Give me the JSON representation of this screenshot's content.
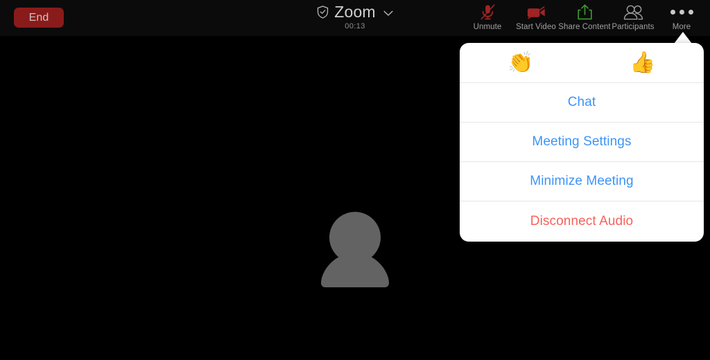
{
  "meeting": {
    "end_button_label": "End",
    "title": "Zoom",
    "timer": "00:13",
    "shield_icon": "shield-check-icon",
    "chevron_icon": "chevron-down-icon"
  },
  "toolbar": {
    "items": [
      {
        "label": "Unmute",
        "icon": "microphone-muted-icon",
        "color": "#a02424"
      },
      {
        "label": "Start Video",
        "icon": "video-off-icon",
        "color": "#a02424"
      },
      {
        "label": "Share Content",
        "icon": "share-upload-icon",
        "color": "#3a9e2a"
      },
      {
        "label": "Participants",
        "icon": "participants-icon",
        "color": "#9a9a9a"
      },
      {
        "label": "More",
        "icon": "more-dots-icon",
        "color": "#c9c9c9"
      }
    ]
  },
  "stage": {
    "avatar_icon": "person-placeholder-icon",
    "avatar_color": "#636363",
    "background_color": "#000000"
  },
  "more_menu": {
    "reactions": [
      {
        "name": "clapping-hands",
        "glyph": "👏"
      },
      {
        "name": "thumbs-up",
        "glyph": "👍"
      }
    ],
    "items": [
      {
        "label": "Chat",
        "style": "blue"
      },
      {
        "label": "Meeting Settings",
        "style": "blue"
      },
      {
        "label": "Minimize Meeting",
        "style": "blue"
      },
      {
        "label": "Disconnect Audio",
        "style": "red"
      }
    ],
    "colors": {
      "blue": "#3d94f6",
      "red": "#f4635d",
      "background": "#ffffff"
    }
  }
}
